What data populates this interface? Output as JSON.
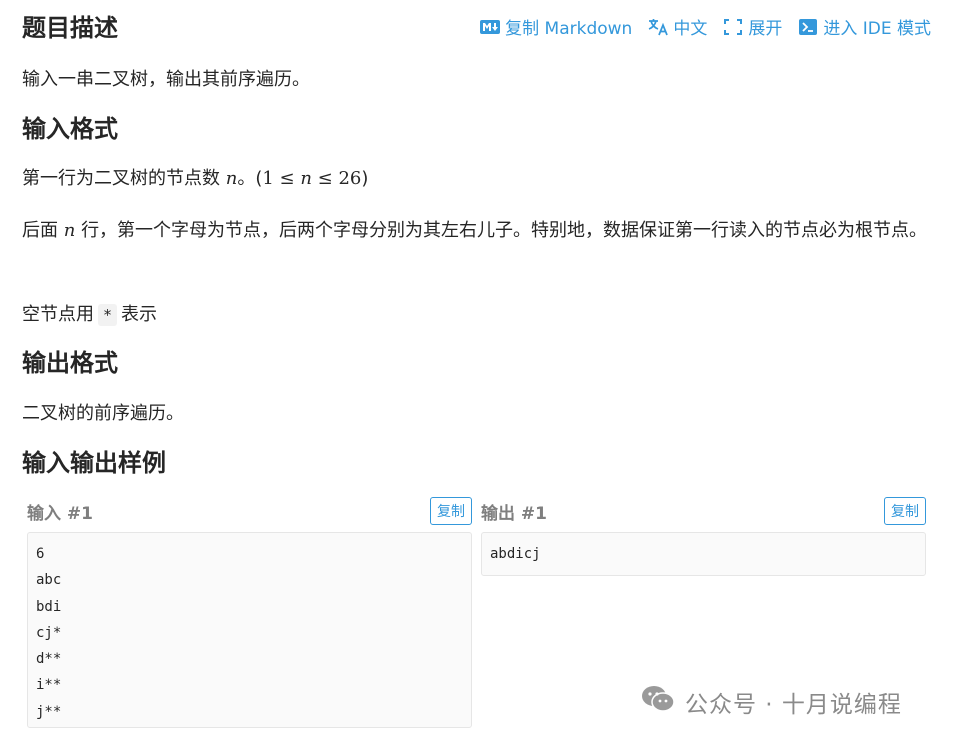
{
  "toolbar": {
    "copy_markdown": "复制 Markdown",
    "language": "中文",
    "expand": "展开",
    "ide_mode": "进入 IDE 模式"
  },
  "sections": {
    "description": {
      "title": "题目描述",
      "text": "输入一串二叉树，输出其前序遍历。"
    },
    "input_format": {
      "title": "输入格式",
      "line1_prefix": "第一行为二叉树的节点数",
      "line1_var": "n",
      "line1_mid": "。(",
      "line1_math_a": "1 ≤ ",
      "line1_math_var": "n",
      "line1_math_b": " ≤ 26",
      "line1_close": ")",
      "line2_prefix": "后面",
      "line2_var": "n",
      "line2_rest": "行，第一个字母为节点，后两个字母分别为其左右儿子。特别地，数据保证第一行读入的节点必为根节点。",
      "line3_prefix": "空节点用",
      "line3_code": "*",
      "line3_suffix": "表示"
    },
    "output_format": {
      "title": "输出格式",
      "text": "二叉树的前序遍历。"
    },
    "examples": {
      "title": "输入输出样例"
    }
  },
  "samples": {
    "input": {
      "title": "输入 #1",
      "copy_label": "复制",
      "content": "6\nabc\nbdi\ncj*\nd**\ni**\nj**"
    },
    "output": {
      "title": "输出 #1",
      "copy_label": "复制",
      "content": "abdicj"
    }
  },
  "watermark": {
    "text": "公众号 · 十月说编程"
  },
  "colors": {
    "accent": "#3498db",
    "text": "#262626",
    "muted": "#7f7f7f"
  }
}
